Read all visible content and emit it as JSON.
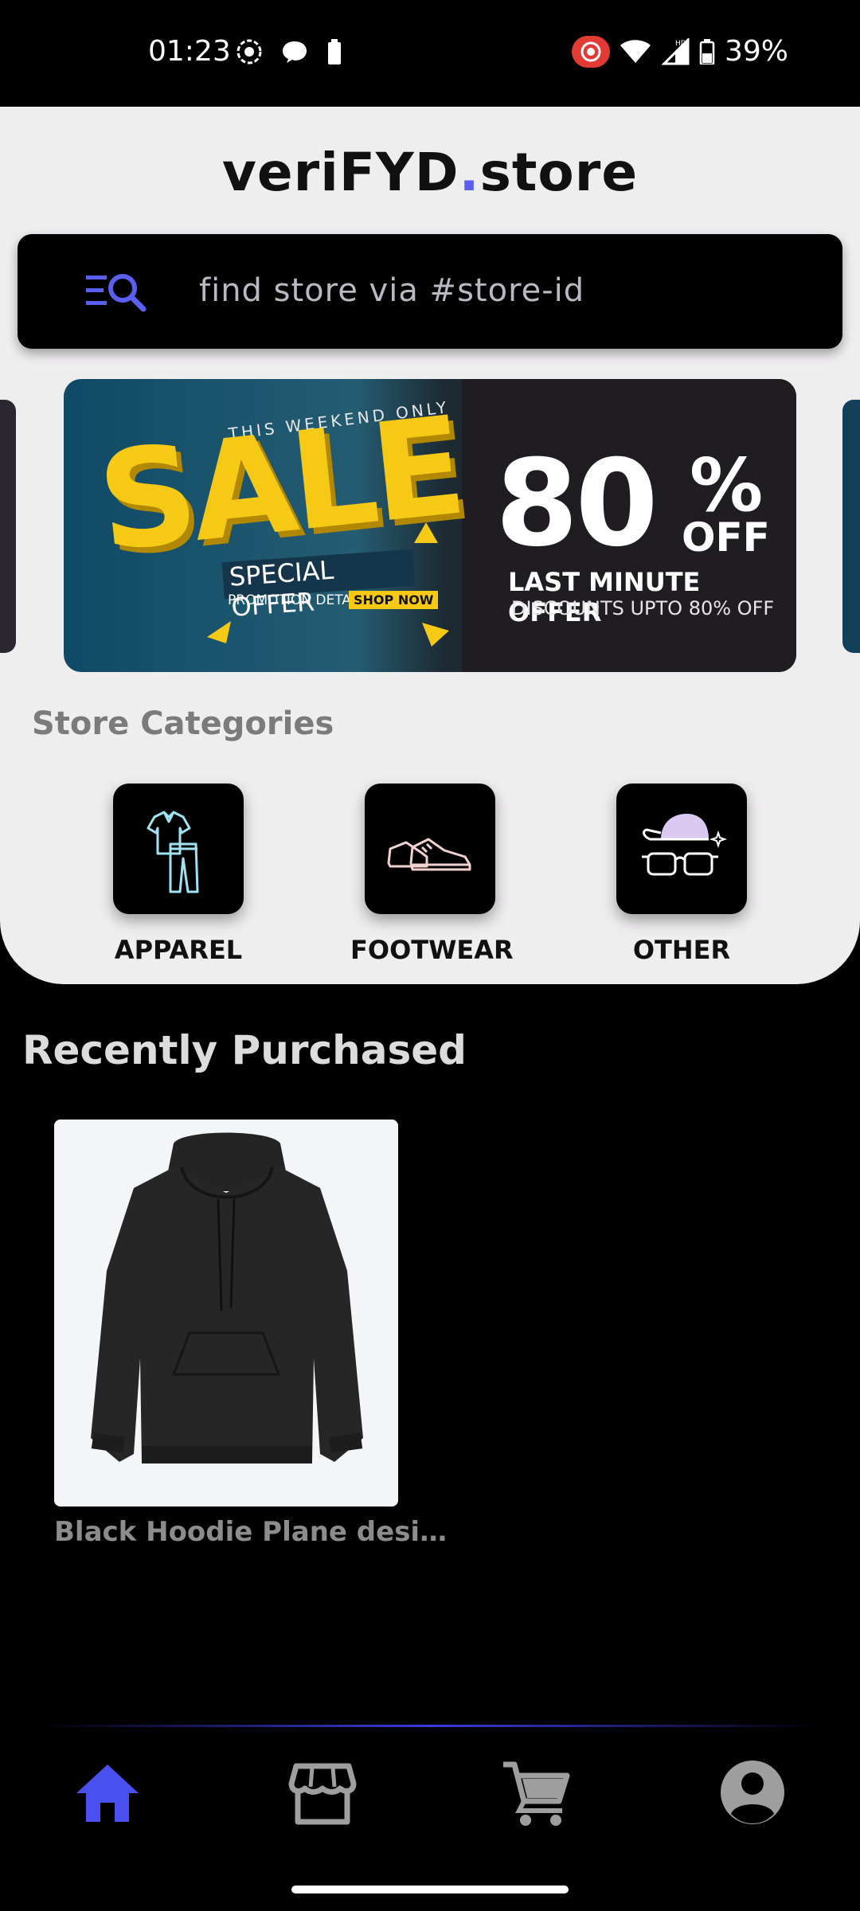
{
  "status_bar": {
    "time": "01:23",
    "battery": "39%",
    "icons_left": [
      "screen-record-icon",
      "chat-bubble-icon",
      "battery-saver-icon"
    ],
    "icons_right": [
      "record-icon",
      "wifi-icon",
      "signal-icon",
      "battery-icon"
    ]
  },
  "header": {
    "logo_part1": "veriFYD",
    "logo_dot": ".",
    "logo_part2": "store"
  },
  "search": {
    "placeholder": "find store via #store-id"
  },
  "banner": {
    "weekend": "THIS WEEKEND ONLY",
    "sale": "SALE",
    "special": "SPECIAL OFFER",
    "promotion": "PROMOTION DETAIL",
    "shop_now": "SHOP NOW",
    "percent_number": "80",
    "percent_sign": "%",
    "off": "OFF",
    "last_minute": "LAST MINUTE OFFER",
    "discounts": "DISCOUNTS UPTO 80% OFF"
  },
  "categories": {
    "title": "Store Categories",
    "items": [
      {
        "label": "APPAREL",
        "icon": "apparel-icon"
      },
      {
        "label": "FOOTWEAR",
        "icon": "footwear-icon"
      },
      {
        "label": "OTHER",
        "icon": "accessories-icon"
      }
    ]
  },
  "recent": {
    "title": "Recently Purchased",
    "items": [
      {
        "name": "Black Hoodie Plane desi…"
      }
    ]
  },
  "bottom_nav": {
    "items": [
      "home-icon",
      "store-icon",
      "cart-icon",
      "profile-icon"
    ],
    "active": "home-icon"
  },
  "colors": {
    "accent": "#5a5ff0",
    "nav_active": "#4a4ff0",
    "nav_inactive": "#9e9e9e",
    "panel_bg": "#efeeef"
  }
}
